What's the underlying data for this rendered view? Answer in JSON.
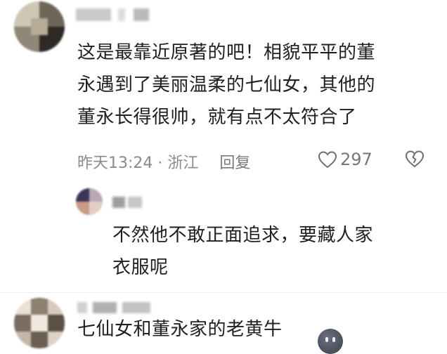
{
  "comments": [
    {
      "text_lines": [
        "这是最靠近原著的吧！相貌平平的董",
        "永遇到了美丽温柔的七仙女，其他的",
        "董永长得很帅，就有点不太符合了"
      ],
      "meta": {
        "time_location": "昨天13:24 · 浙江",
        "reply_label": "回复",
        "like_count": "297"
      },
      "replies": [
        {
          "text_lines": [
            "不然他不敢正面追求，要藏人家",
            "衣服呢"
          ]
        }
      ]
    },
    {
      "text_lines": [
        "七仙女和董永家的老黄牛"
      ]
    }
  ],
  "icons": {
    "like": "heart-outline-icon",
    "dislike": "broken-heart-icon",
    "emoji": "dark-face-emoji-icon"
  },
  "colors": {
    "text": "#1f1f1f",
    "meta": "#8a8a8a",
    "background": "#ffffff"
  }
}
